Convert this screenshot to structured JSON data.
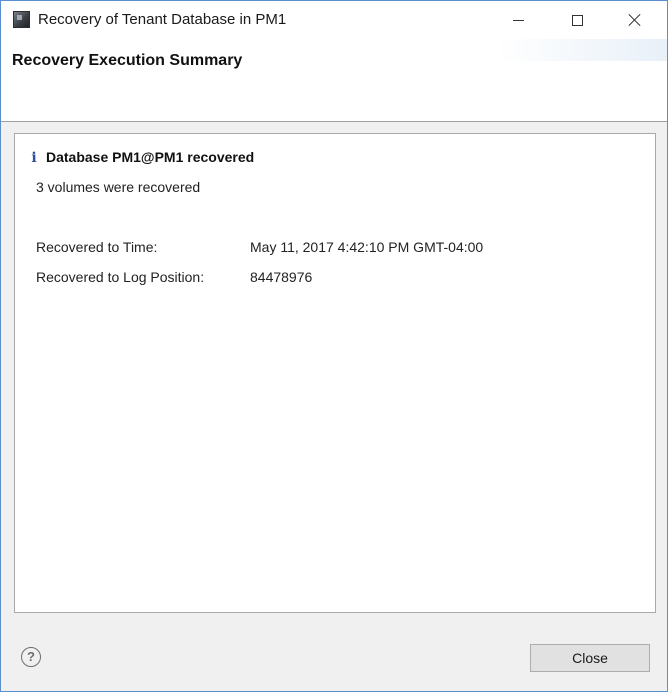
{
  "window": {
    "title": "Recovery of Tenant Database in PM1",
    "controls": {
      "minimize": "minimize-icon",
      "maximize": "maximize-icon",
      "close": "close-icon"
    }
  },
  "header": {
    "title": "Recovery Execution Summary"
  },
  "content": {
    "info_icon": "info-icon",
    "status_title": "Database PM1@PM1 recovered",
    "status_subtitle": "3 volumes were recovered",
    "details": [
      {
        "label": "Recovered to Time:",
        "value": "May 11, 2017 4:42:10 PM GMT-04:00"
      },
      {
        "label": "Recovered to Log Position:",
        "value": "84478976"
      }
    ]
  },
  "footer": {
    "help_glyph": "?",
    "close_label": "Close"
  },
  "colors": {
    "window_border": "#5a8fcf",
    "dialog_background": "#f0f0f0",
    "info_icon": "#2f4f9a",
    "button_face": "#e1e1e1"
  }
}
